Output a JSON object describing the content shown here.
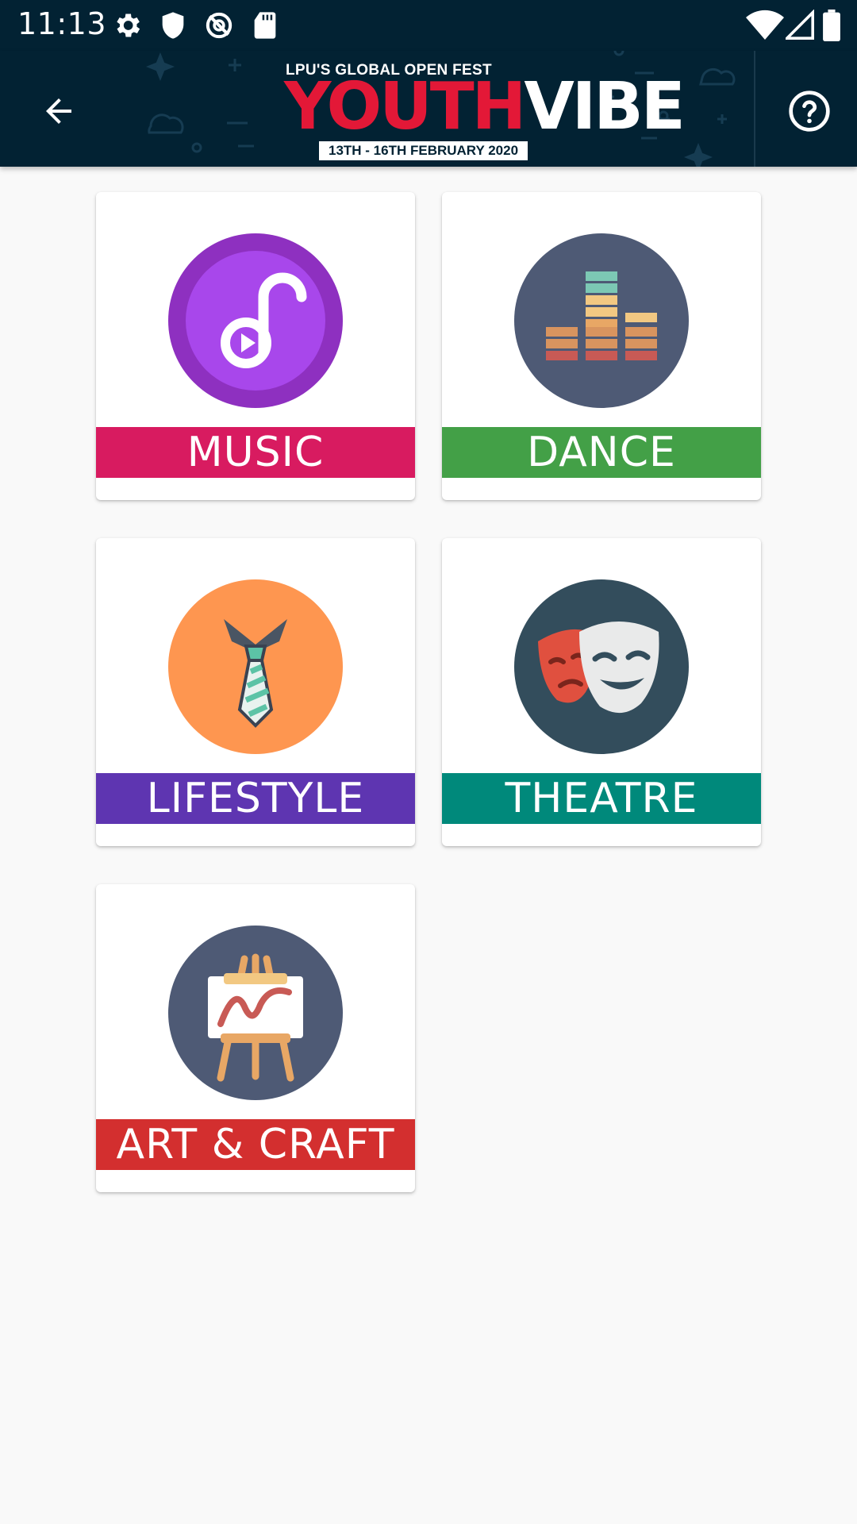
{
  "status_bar": {
    "time": "11:13",
    "icons": [
      "gear-icon",
      "shield-icon",
      "no-sync-icon",
      "sd-card-icon",
      "wifi-icon",
      "cell-signal-icon",
      "battery-icon"
    ]
  },
  "app_bar": {
    "logo": {
      "subtitle": "LPU'S GLOBAL OPEN FEST",
      "title_part1": "YOUTH",
      "title_part2": "VIBE",
      "dates": "13TH - 16TH FEBRUARY 2020"
    },
    "back_icon": "arrow-back-icon",
    "help_icon": "help-circle-icon",
    "background": "#022233"
  },
  "categories": [
    {
      "label": "MUSIC",
      "color": "#d81b60",
      "icon": "music-note-icon"
    },
    {
      "label": "DANCE",
      "color": "#43a047",
      "icon": "equalizer-icon"
    },
    {
      "label": "LIFESTYLE",
      "color": "#5e35b1",
      "icon": "tie-icon"
    },
    {
      "label": "THEATRE",
      "color": "#00897b",
      "icon": "theatre-masks-icon"
    },
    {
      "label": "ART & CRAFT",
      "color": "#d32f2f",
      "icon": "easel-icon"
    }
  ]
}
